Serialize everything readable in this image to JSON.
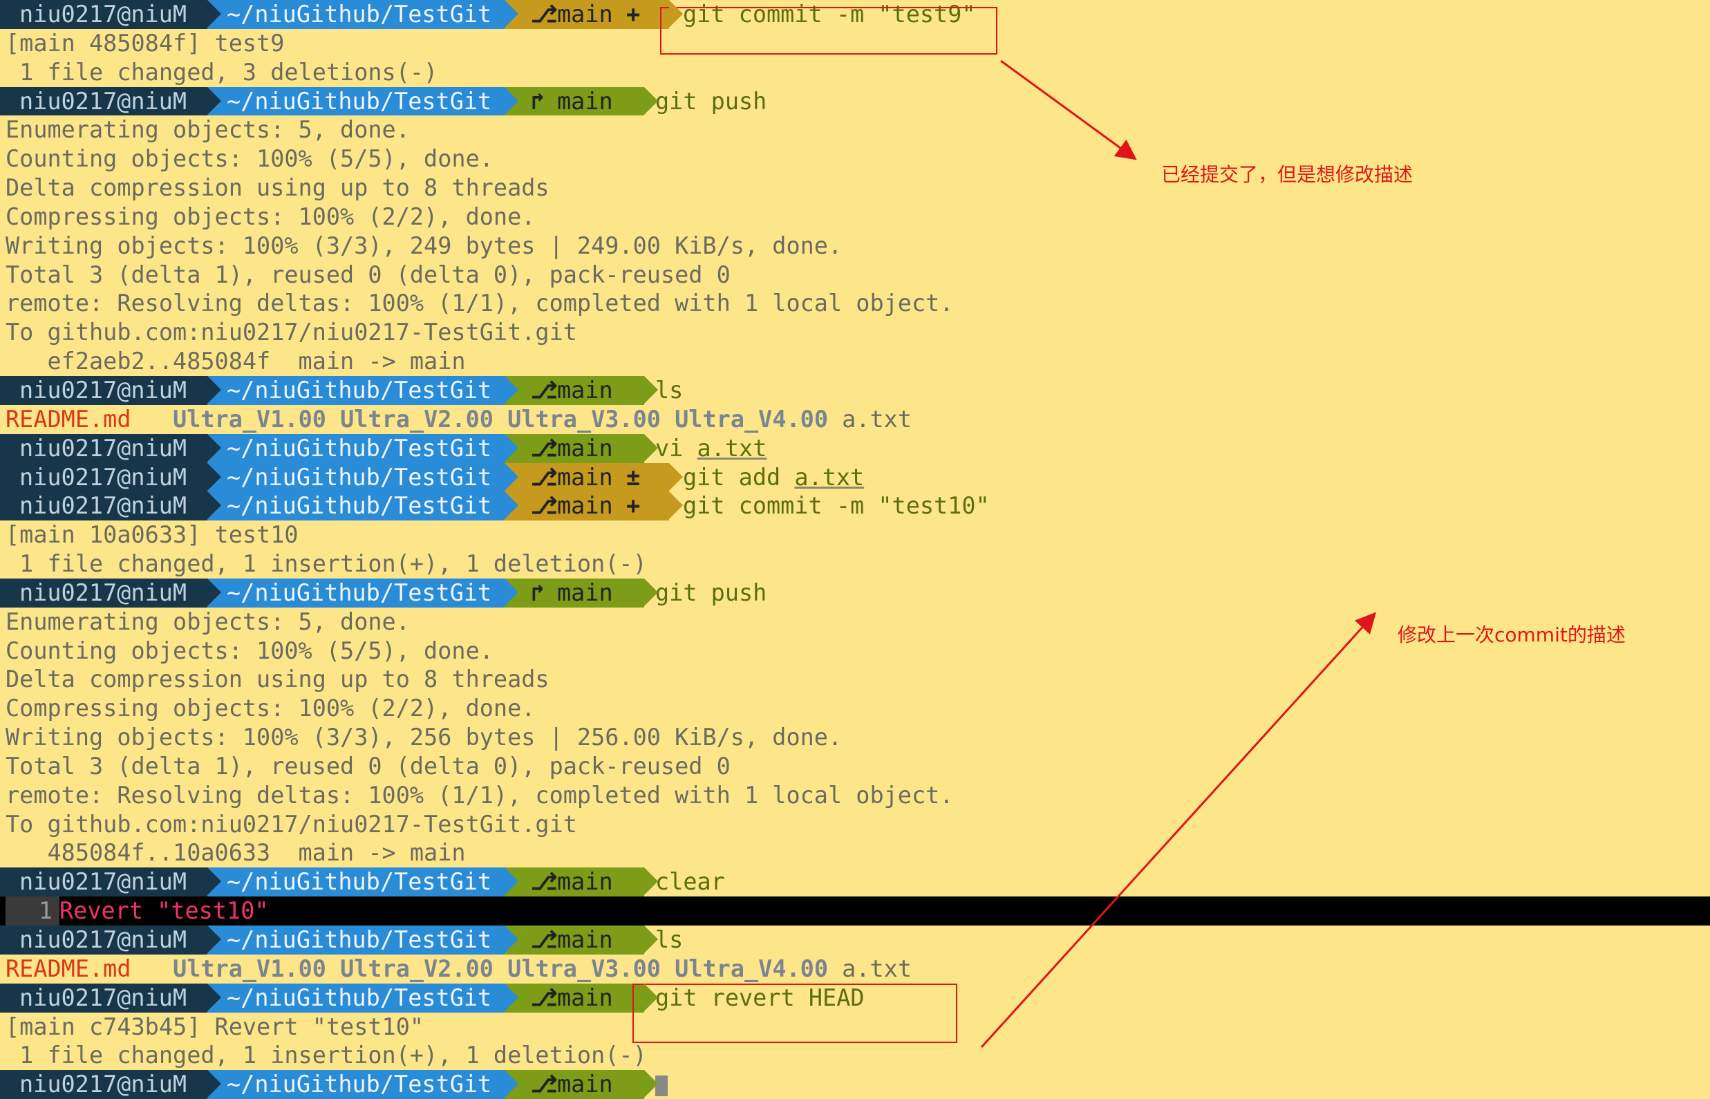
{
  "prompt": {
    "user": "niu0217@niuM",
    "path": "~/niuGithub/TestGit",
    "branch": "main",
    "branch_icon": "git-branch-icon",
    "dirty_plus": "+",
    "dirty_plusminus": "±",
    "upstream_icon": "↱"
  },
  "lines": [
    {
      "kind": "prompt",
      "state": "dirty",
      "mark": "+",
      "cmd": "git commit -m \"test9\""
    },
    {
      "kind": "text",
      "text": "[main 485084f] test9"
    },
    {
      "kind": "text",
      "text": " 1 file changed, 3 deletions(-)"
    },
    {
      "kind": "prompt",
      "state": "upstream",
      "cmd": "git push"
    },
    {
      "kind": "text",
      "text": "Enumerating objects: 5, done."
    },
    {
      "kind": "text",
      "text": "Counting objects: 100% (5/5), done."
    },
    {
      "kind": "text",
      "text": "Delta compression using up to 8 threads"
    },
    {
      "kind": "text",
      "text": "Compressing objects: 100% (2/2), done."
    },
    {
      "kind": "text",
      "text": "Writing objects: 100% (3/3), 249 bytes | 249.00 KiB/s, done."
    },
    {
      "kind": "text",
      "text": "Total 3 (delta 1), reused 0 (delta 0), pack-reused 0"
    },
    {
      "kind": "text",
      "text": "remote: Resolving deltas: 100% (1/1), completed with 1 local object."
    },
    {
      "kind": "text",
      "text": "To github.com:niu0217/niu0217-TestGit.git"
    },
    {
      "kind": "text",
      "text": "   ef2aeb2..485084f  main -> main"
    },
    {
      "kind": "prompt",
      "state": "clean",
      "cmd": "ls"
    },
    {
      "kind": "ls"
    },
    {
      "kind": "prompt",
      "state": "clean",
      "cmd": "vi ",
      "arg": "a.txt"
    },
    {
      "kind": "prompt",
      "state": "dirty",
      "mark": "±",
      "cmd": "git add ",
      "arg": "a.txt"
    },
    {
      "kind": "prompt",
      "state": "dirty",
      "mark": "+",
      "cmd": "git commit -m \"test10\""
    },
    {
      "kind": "text",
      "text": "[main 10a0633] test10"
    },
    {
      "kind": "text",
      "text": " 1 file changed, 1 insertion(+), 1 deletion(-)"
    },
    {
      "kind": "prompt",
      "state": "upstream",
      "cmd": "git push"
    },
    {
      "kind": "text",
      "text": "Enumerating objects: 5, done."
    },
    {
      "kind": "text",
      "text": "Counting objects: 100% (5/5), done."
    },
    {
      "kind": "text",
      "text": "Delta compression using up to 8 threads"
    },
    {
      "kind": "text",
      "text": "Compressing objects: 100% (2/2), done."
    },
    {
      "kind": "text",
      "text": "Writing objects: 100% (3/3), 256 bytes | 256.00 KiB/s, done."
    },
    {
      "kind": "text",
      "text": "Total 3 (delta 1), reused 0 (delta 0), pack-reused 0"
    },
    {
      "kind": "text",
      "text": "remote: Resolving deltas: 100% (1/1), completed with 1 local object."
    },
    {
      "kind": "text",
      "text": "To github.com:niu0217/niu0217-TestGit.git"
    },
    {
      "kind": "text",
      "text": "   485084f..10a0633  main -> main"
    },
    {
      "kind": "prompt",
      "state": "clean",
      "cmd": "clear"
    },
    {
      "kind": "vim",
      "num": "1",
      "text": "Revert \"test10\""
    },
    {
      "kind": "prompt",
      "state": "clean",
      "cmd": "ls"
    },
    {
      "kind": "ls"
    },
    {
      "kind": "prompt",
      "state": "clean",
      "cmd": "git revert HEAD"
    },
    {
      "kind": "text",
      "text": "[main c743b45] Revert \"test10\""
    },
    {
      "kind": "text",
      "text": " 1 file changed, 1 insertion(+), 1 deletion(-)"
    },
    {
      "kind": "prompt",
      "state": "clean",
      "cmd": "",
      "cursor": true
    }
  ],
  "ls_output": {
    "readme": "README.md",
    "dirs": [
      "Ultra_V1.00",
      "Ultra_V2.00",
      "Ultra_V3.00",
      "Ultra_V4.00"
    ],
    "file": "a.txt"
  },
  "annotations": {
    "note1": "已经提交了，但是想修改描述",
    "note2": "修改上一次commit的描述"
  },
  "colors": {
    "background": "#FDE68A",
    "annotation_red": "#E0151A"
  }
}
